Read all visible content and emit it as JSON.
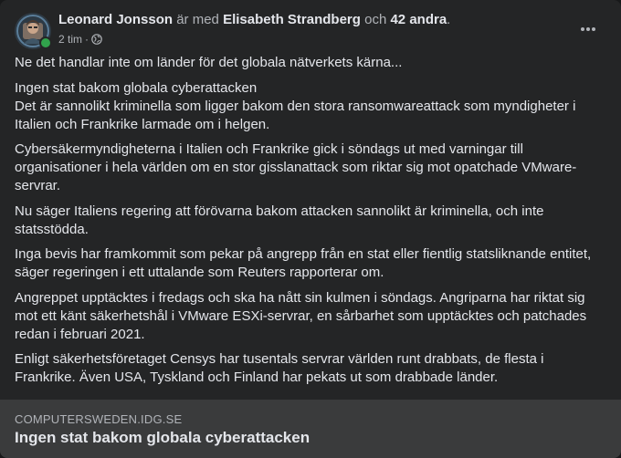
{
  "post": {
    "author": "Leonard Jonsson",
    "with_text": "är med",
    "tagged": "Elisabeth Strandberg",
    "and_text": "och",
    "others": "42 andra",
    "period": ".",
    "time": "2 tim",
    "dot": "·",
    "privacy_icon": "globe-icon",
    "more_icon": "ellipsis-icon"
  },
  "body": {
    "paragraphs": [
      [
        "Ne det handlar inte om länder för det globala nätverkets kärna..."
      ],
      [
        "Ingen stat bakom globala cyberattacken",
        "Det är sannolikt kriminella som ligger bakom den stora ransomwareattack som myndigheter i Italien och Frankrike larmade om i helgen."
      ],
      [
        "Cybersäkermyndigheterna i Italien och Frankrike gick i söndags ut med varningar till organisationer i hela världen om en stor gisslanattack som riktar sig mot opatchade VMware-servrar."
      ],
      [
        "Nu säger Italiens regering att förövarna bakom attacken sannolikt är kriminella, och inte statsstödda."
      ],
      [
        "Inga bevis har framkommit som pekar på angrepp från en stat eller fientlig statsliknande entitet, säger regeringen i ett uttalande som Reuters rapporterar om."
      ],
      [
        "Angreppet upptäcktes i fredags och ska ha nått sin kulmen i söndags. Angriparna har riktat sig mot ett känt säkerhetshål i VMware ESXi-servrar, en sårbarhet som upptäcktes och patchades redan i februari 2021."
      ],
      [
        "Enligt säkerhetsföretaget Censys har tusentals servrar världen runt drabbats, de flesta i Frankrike. Även USA, Tyskland och Finland har pekats ut som drabbade länder."
      ]
    ]
  },
  "link_preview": {
    "domain": "COMPUTERSWEDEN.IDG.SE",
    "title": "Ingen stat bakom globala cyberattacken"
  },
  "colors": {
    "card_bg": "#242526",
    "preview_bg": "#3a3b3c",
    "text": "#e4e6eb",
    "muted": "#b0b3b8",
    "online": "#31a24c"
  }
}
